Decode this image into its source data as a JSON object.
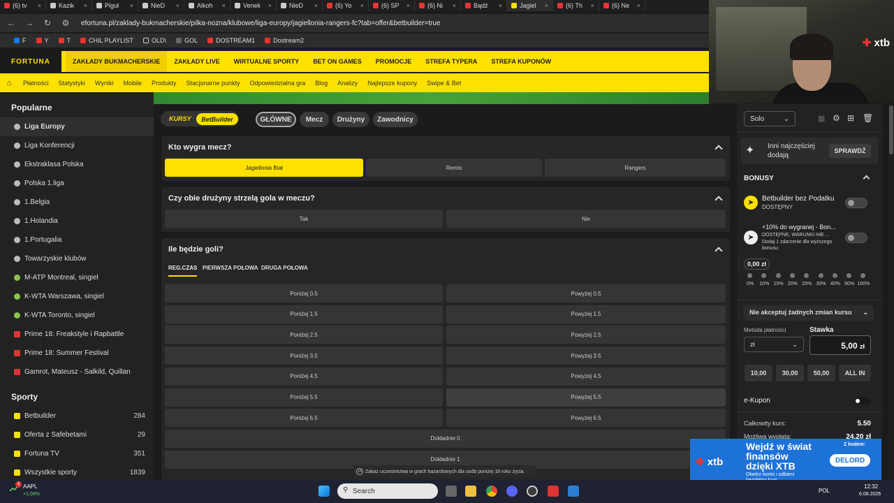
{
  "browser": {
    "tabs": [
      "(6) tv",
      "Kazik",
      "Piguł",
      "NieD",
      "Alkoh",
      "Venek",
      "NieD",
      "(6) Yo",
      "(6) SP",
      "(6) Ni",
      "Bądź",
      "Jagiel",
      "(6) Th",
      "(6) Ne"
    ],
    "active_tab_index": 11,
    "url": "efortuna.pl/zaklady-bukmacherskie/pilka-nozna/klubowe/liga-europy/jagiellonia-rangers-fc?tab=offer&betbuilder=true",
    "bookmarks": [
      "F",
      "Y",
      "T",
      "CHIL PLAYLIST",
      "OLD\\",
      "GOL",
      "DOSTREAM1",
      "Dostream2"
    ]
  },
  "site": {
    "logo": "FORTUNA",
    "main_nav": [
      "ZAKŁADY BUKMACHERSKIE",
      "ZAKŁADY LIVE",
      "WIRTUALNE SPORTY",
      "BET ON GAMES",
      "PROMOCJE",
      "STREFA TYPERA",
      "STREFA KUPONÓW"
    ],
    "sub_nav": [
      "Płatności",
      "Statystyki",
      "Wyniki",
      "Mobile",
      "Produkty",
      "Stacjonarne punkty",
      "Odpowiedzialna gra",
      "Blog",
      "Analizy",
      "Najlepsze kupony",
      "Swipe & Bet"
    ]
  },
  "webcam": {
    "brand": "xtb"
  },
  "sidebar": {
    "popular_title": "Popularne",
    "popular": [
      {
        "label": "Liga Europy",
        "icon": "ball",
        "selected": true
      },
      {
        "label": "Liga Konferencji",
        "icon": "ball"
      },
      {
        "label": "Ekstraklasa Polska",
        "icon": "ball"
      },
      {
        "label": "Polska 1.liga",
        "icon": "ball"
      },
      {
        "label": "1.Belgia",
        "icon": "ball"
      },
      {
        "label": "1.Holandia",
        "icon": "ball"
      },
      {
        "label": "1.Portugalia",
        "icon": "ball"
      },
      {
        "label": "Towarzyskie klubów",
        "icon": "ball"
      },
      {
        "label": "M-ATP Montreal, singiel",
        "icon": "tennis"
      },
      {
        "label": "K-WTA Warszawa, singiel",
        "icon": "tennis"
      },
      {
        "label": "K-WTA Toronto, singiel",
        "icon": "tennis"
      },
      {
        "label": "Prime 18: Freakstyle i Rapbattle",
        "icon": "mma"
      },
      {
        "label": "Prime 18: Summer Festival",
        "icon": "mma"
      },
      {
        "label": "Gamrot, Mateusz - Salkild, Quillan",
        "icon": "mma"
      }
    ],
    "sports_title": "Sporty",
    "sports": [
      {
        "label": "Betbuilder",
        "count": "284"
      },
      {
        "label": "Oferta z Safebetami",
        "count": "29"
      },
      {
        "label": "Fortuna TV",
        "count": "351"
      },
      {
        "label": "Wszystkie sporty",
        "count": "1839"
      }
    ]
  },
  "main": {
    "mode_labels": [
      "KURSY",
      "BetBuilder"
    ],
    "filter_tabs": [
      "GŁÓWNE",
      "Mecz",
      "Drużyny",
      "Zawodnicy"
    ],
    "market_winner": {
      "title": "Kto wygra mecz?",
      "options": [
        "Jagiellonia Biał",
        "Remis",
        "Rangers"
      ]
    },
    "market_btts": {
      "title": "Czy obie drużyny strzelą gola w meczu?",
      "options": [
        "Tak",
        "Nie"
      ]
    },
    "market_goals": {
      "title": "Ile będzie goli?",
      "tabs": [
        "REG.CZAS",
        "PIERWSZA POŁOWA",
        "DRUGA POŁOWA"
      ],
      "under": [
        "Poniżej 0.5",
        "Poniżej 1.5",
        "Poniżej 2.5",
        "Poniżej 3.5",
        "Poniżej 4.5",
        "Poniżej 5.5",
        "Poniżej 6.5"
      ],
      "over": [
        "Powyżej 0.5",
        "Powyżej 1.5",
        "Powyżej 2.5",
        "Powyżej 3.5",
        "Powyżej 4.5",
        "Powyżej 5.5",
        "Powyżej 6.5"
      ],
      "exact": [
        "Dokładnie 0",
        "Dokładnie 1"
      ]
    },
    "notice": "Zakaz uczestnictwa w grach hazardowych dla osób poniżej 18 roku życia."
  },
  "betslip": {
    "mode": "Solo",
    "popular_text": "Inni najczęściej dodają",
    "check_button": "SPRAWDŹ",
    "bonuses_title": "BONUSY",
    "bonus1_title": "Betbuilder bez Podatku",
    "bonus1_status": "DOSTĘPNY",
    "bonus2_title": "+10% do wygranej - Bon...",
    "bonus2_status": "DOSTĘPNE, WARUNKI NIE ...",
    "bonus2_note": "Dodaj 1 zdarzenie dla wyższego bonusu",
    "bonus_amount": "0,00 zł",
    "bonus_scale": [
      "0%",
      "10%",
      "15%",
      "20%",
      "25%",
      "30%",
      "40%",
      "50%",
      "100%"
    ],
    "odds_change": "Nie akceptuj żadnych zmian kursu",
    "payment_label": "Metoda płatności",
    "payment_value": "zł",
    "stake_label": "Stawka",
    "stake_value": "5,00",
    "stake_currency": "zł",
    "quick_stakes": [
      "10,00",
      "30,00",
      "50,00",
      "ALL IN"
    ],
    "ekupon": "e-Kupon",
    "total_odds_label": "Całkowity kurs:",
    "total_odds": "5.50",
    "payout_label": "Możliwa wypłata:",
    "payout": "24,20 zł"
  },
  "ad": {
    "line1": "Wejdź w świat",
    "line2": "finansów",
    "line3": "dzięki XTB",
    "small": "Otwórz konto i odbierz bezpłatny kurs",
    "code_label": "Z kodem:",
    "code": "DELORD",
    "brand": "xtb"
  },
  "taskbar": {
    "stock": "AAPL",
    "stock_change": "+1,08%",
    "badge": "3",
    "search": "Search",
    "lang": "POL",
    "time": "12:32",
    "date": "6.08.2026"
  },
  "colors": {
    "brand_yellow": "#ffe100",
    "panel": "#262626",
    "button": "#353535"
  }
}
